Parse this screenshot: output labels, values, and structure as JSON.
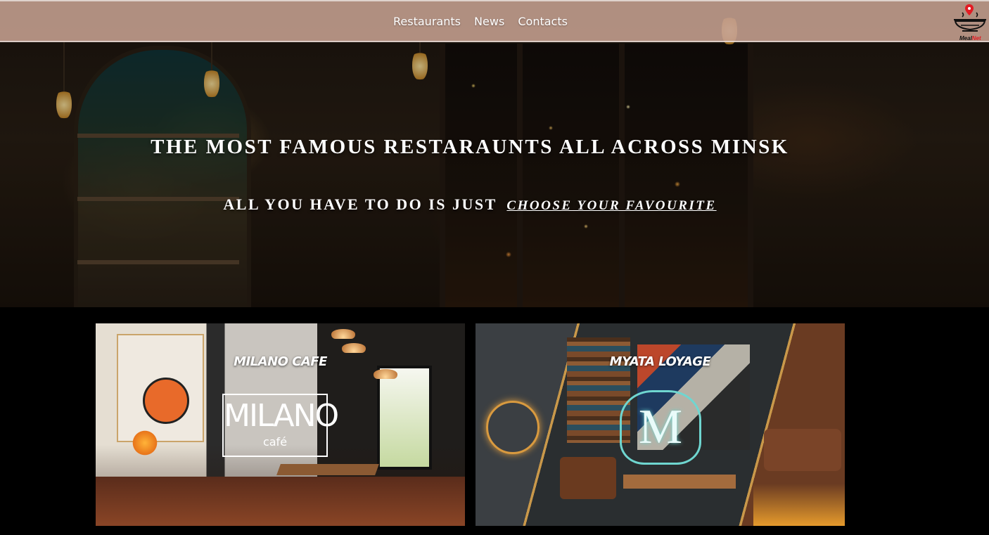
{
  "nav": {
    "links": [
      "Restaurants",
      "News",
      "Contacts"
    ],
    "logo_text_black": "Meal",
    "logo_text_red": "Net"
  },
  "hero": {
    "title": "THE MOST FAMOUS RESTARAUNTS ALL ACROSS MINSK",
    "subtitle": "ALL YOU HAVE TO DO IS JUST",
    "cta_link": "CHOOSE YOUR FAVOURITE"
  },
  "cards": [
    {
      "title": "MILANO CAFE",
      "sign_main": "MILANO",
      "sign_sub": "café"
    },
    {
      "title": "MYATA LOYAGE",
      "emblem": "M"
    }
  ],
  "colors": {
    "navbar_bg": "#c6a091",
    "logo_accent": "#e31b23",
    "page_bg": "#000000",
    "text": "#ffffff"
  },
  "icons": {
    "logo": "steaming-dish-with-location-pin-icon"
  }
}
